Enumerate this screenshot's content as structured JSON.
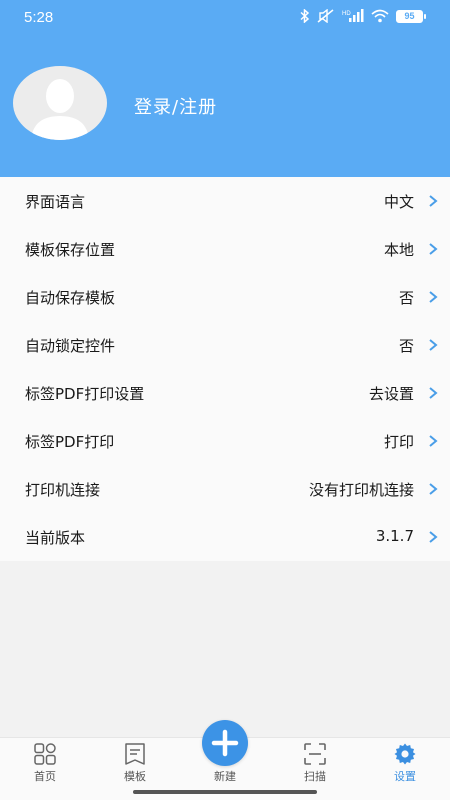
{
  "status_bar": {
    "time": "5:28",
    "battery": "95",
    "network_label": "HD"
  },
  "profile": {
    "login_label": "登录/注册"
  },
  "settings": [
    {
      "label": "界面语言",
      "value": "中文"
    },
    {
      "label": "模板保存位置",
      "value": "本地"
    },
    {
      "label": "自动保存模板",
      "value": "否"
    },
    {
      "label": "自动锁定控件",
      "value": "否"
    },
    {
      "label": "标签PDF打印设置",
      "value": "去设置"
    },
    {
      "label": "标签PDF打印",
      "value": "打印"
    },
    {
      "label": "打印机连接",
      "value": "没有打印机连接"
    },
    {
      "label": "当前版本",
      "value": "3.1.7"
    }
  ],
  "tabbar": {
    "tabs": [
      {
        "label": "首页",
        "icon": "home-grid-icon"
      },
      {
        "label": "模板",
        "icon": "template-icon"
      },
      {
        "label": "新建",
        "icon": "plus-icon"
      },
      {
        "label": "扫描",
        "icon": "scan-icon"
      },
      {
        "label": "设置",
        "icon": "gear-icon"
      }
    ],
    "active": "设置"
  },
  "colors": {
    "header": "#5aabf4",
    "accent": "#3b8fe0",
    "chevron": "#4a9ee8"
  }
}
